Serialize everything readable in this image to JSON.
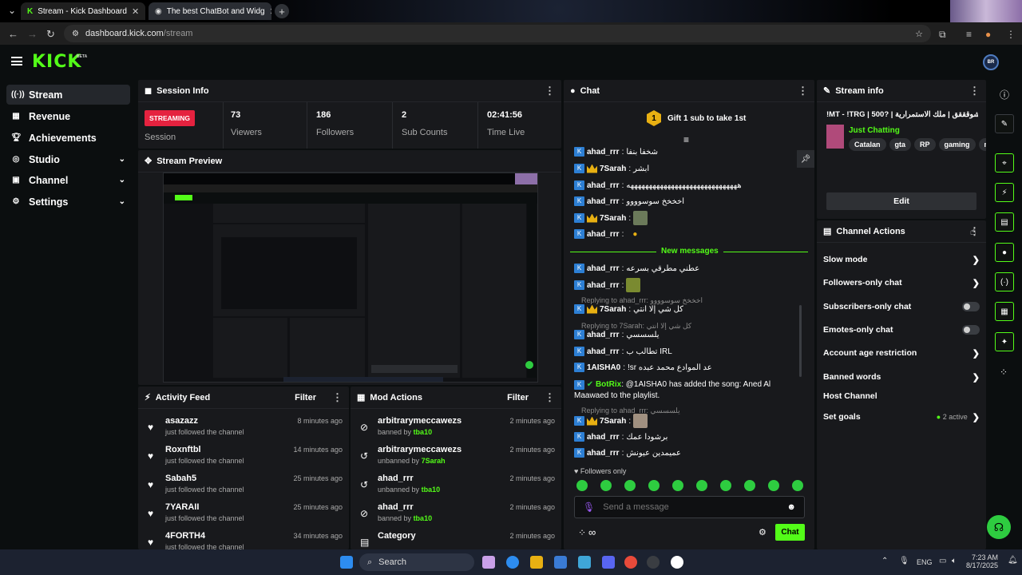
{
  "browser": {
    "tabs": [
      {
        "title": "Stream - Kick Dashboard"
      },
      {
        "title": "The best ChatBot and Widg"
      }
    ],
    "url_domain": "dashboard.kick.com",
    "url_path": "/stream"
  },
  "header": {
    "logo": "KICK",
    "beta": "BETA",
    "avatar": "BR"
  },
  "sidebar": {
    "items": [
      {
        "label": "Stream",
        "icon": "broadcast-icon"
      },
      {
        "label": "Revenue",
        "icon": "revenue-icon"
      },
      {
        "label": "Achievements",
        "icon": "trophy-icon"
      },
      {
        "label": "Studio",
        "icon": "studio-icon"
      },
      {
        "label": "Channel",
        "icon": "channel-icon"
      },
      {
        "label": "Settings",
        "icon": "gear-icon"
      }
    ]
  },
  "session": {
    "title": "Session Info",
    "status": "STREAMING",
    "status_label": "Session",
    "viewers": "73",
    "viewers_label": "Viewers",
    "followers": "186",
    "followers_label": "Followers",
    "subs": "2",
    "subs_label": "Sub Counts",
    "time": "02:41:56",
    "time_label": "Time Live"
  },
  "preview": {
    "title": "Stream Preview"
  },
  "activity": {
    "title": "Activity Feed",
    "filter": "Filter",
    "items": [
      {
        "name": "asazazz",
        "text": "just followed the channel",
        "time": "8 minutes ago"
      },
      {
        "name": "Roxnftbl",
        "text": "just followed the channel",
        "time": "14 minutes ago"
      },
      {
        "name": "Sabah5",
        "text": "just followed the channel",
        "time": "25 minutes ago"
      },
      {
        "name": "7YARAII",
        "text": "just followed the channel",
        "time": "25 minutes ago"
      },
      {
        "name": "4FORTH4",
        "text": "just followed the channel",
        "time": "34 minutes ago"
      }
    ]
  },
  "mod": {
    "title": "Mod Actions",
    "filter": "Filter",
    "items": [
      {
        "name": "arbitrarymeccawezs",
        "action": "banned by",
        "by": "tba10",
        "time": "2 minutes ago"
      },
      {
        "name": "arbitrarymeccawezs",
        "action": "unbanned by",
        "by": "7Sarah",
        "time": "2 minutes ago"
      },
      {
        "name": "ahad_rrr",
        "action": "unbanned by",
        "by": "tba10",
        "time": "2 minutes ago"
      },
      {
        "name": "ahad_rrr",
        "action": "banned by",
        "by": "tba10",
        "time": "2 minutes ago"
      },
      {
        "name": "Category",
        "action": "",
        "by": "",
        "time": "2 minutes ago"
      }
    ]
  },
  "chat": {
    "title": "Chat",
    "gift": "Gift 1 sub to take 1st",
    "gift_count": "1",
    "new_messages": "New messages",
    "messages": [
      {
        "user": "ahad_rrr",
        "text": "شخفا بنفا"
      },
      {
        "user": "7Sarah",
        "text": "ابشر"
      },
      {
        "user": "ahad_rrr",
        "text": "ههههههههههههههههههههههههههههههه"
      },
      {
        "user": "ahad_rrr",
        "text": "اخخخخ سوسوووو"
      },
      {
        "user": "7Sarah",
        "text": ""
      },
      {
        "user": "ahad_rrr",
        "text": ""
      },
      {
        "user": "ahad_rrr",
        "text": "عطني مطرقي بسرعه"
      },
      {
        "user": "ahad_rrr",
        "text": ""
      },
      {
        "user": "7Sarah",
        "text": "كل شي إلا انتي"
      },
      {
        "user": "ahad_rrr",
        "text": "يلسسسي"
      },
      {
        "user": "ahad_rrr",
        "text": "تطالب ب IRL"
      },
      {
        "user": "1AISHA0",
        "text": "!sr عد الموادع محمد عبده"
      },
      {
        "user": "BotRix",
        "text": "@1AISHA0 has added the song: Aned Al Maawaed to the playlist."
      },
      {
        "user": "7Sarah",
        "text": ""
      },
      {
        "user": "ahad_rrr",
        "text": "برشودا عمك"
      },
      {
        "user": "ahad_rrr",
        "text": "عميمدين عيونش"
      }
    ],
    "replies": [
      {
        "text": "Replying to ahad_rrr: اخخخخ سوسوووو"
      },
      {
        "text": "Replying to 7Sarah: كل شي إلا انتي"
      },
      {
        "text": "Replying to ahad_rrr: يلسسسي"
      }
    ],
    "followers_only": "Followers only",
    "placeholder": "Send a message",
    "send": "Chat"
  },
  "stream_info": {
    "title": "Stream info",
    "stream_title": "!MT - !TRG | 500? | الشوقققق | ملك الاستمرارية",
    "category": "Just Chatting",
    "tags": [
      "Catalan",
      "gta",
      "RP",
      "gaming",
      "mt"
    ],
    "edit": "Edit"
  },
  "channel_actions": {
    "title": "Channel Actions",
    "items": [
      {
        "label": "Slow mode",
        "kind": "chevron"
      },
      {
        "label": "Followers-only chat",
        "kind": "chevron"
      },
      {
        "label": "Subscribers-only chat",
        "kind": "toggle"
      },
      {
        "label": "Emotes-only chat",
        "kind": "toggle"
      },
      {
        "label": "Account age restriction",
        "kind": "chevron"
      },
      {
        "label": "Banned words",
        "kind": "chevron"
      },
      {
        "label": "Host Channel",
        "kind": "none"
      },
      {
        "label": "Set goals",
        "kind": "chevron",
        "extra": "2 active"
      }
    ]
  },
  "taskbar": {
    "search": "Search",
    "lang": "ENG",
    "time": "7:23 AM",
    "date": "8/17/2025"
  },
  "colors": {
    "accent": "#53fc18",
    "streaming": "#e5223f",
    "panel": "#18191c",
    "bg": "#0b0e0f"
  }
}
